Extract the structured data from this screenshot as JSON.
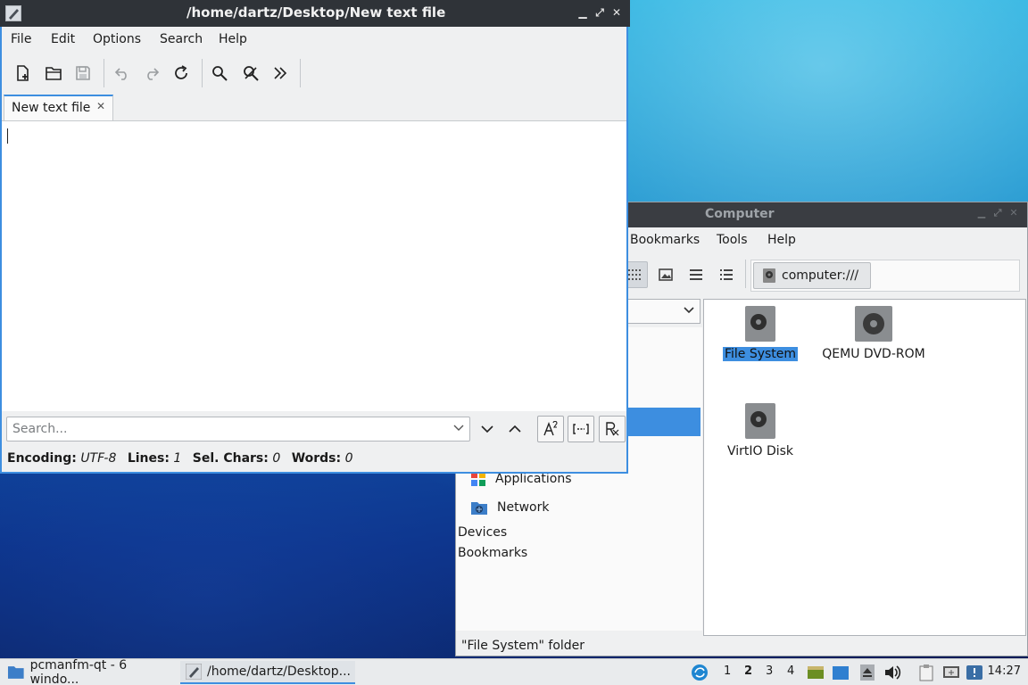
{
  "file_manager": {
    "title": "Computer",
    "menu": [
      "Bookmarks",
      "Tools",
      "Help"
    ],
    "path": "computer:///",
    "sidebar": {
      "items": [
        "Applications",
        "Network"
      ],
      "headers": [
        "Devices",
        "Bookmarks"
      ]
    },
    "files": [
      {
        "name": "File System",
        "selected": true
      },
      {
        "name": "QEMU DVD-ROM",
        "selected": false
      },
      {
        "name": "VirtIO Disk",
        "selected": false
      }
    ],
    "status": "\"File System\" folder"
  },
  "editor": {
    "title": "/home/dartz/Desktop/New text file",
    "menu": [
      "File",
      "Edit",
      "Options",
      "Search",
      "Help"
    ],
    "tab": "New text file",
    "search_placeholder": "Search...",
    "status": {
      "encoding_label": "Encoding:",
      "encoding": "UTF-8",
      "lines_label": "Lines:",
      "lines": "1",
      "sel_label": "Sel. Chars:",
      "sel": "0",
      "words_label": "Words:",
      "words": "0"
    }
  },
  "taskbar": {
    "tasks": [
      "pcmanfm-qt - 6 windo...",
      "/home/dartz/Desktop..."
    ],
    "desktops": [
      "1",
      "2",
      "3",
      "4"
    ],
    "current_desktop": "2",
    "clock": "14:27"
  }
}
